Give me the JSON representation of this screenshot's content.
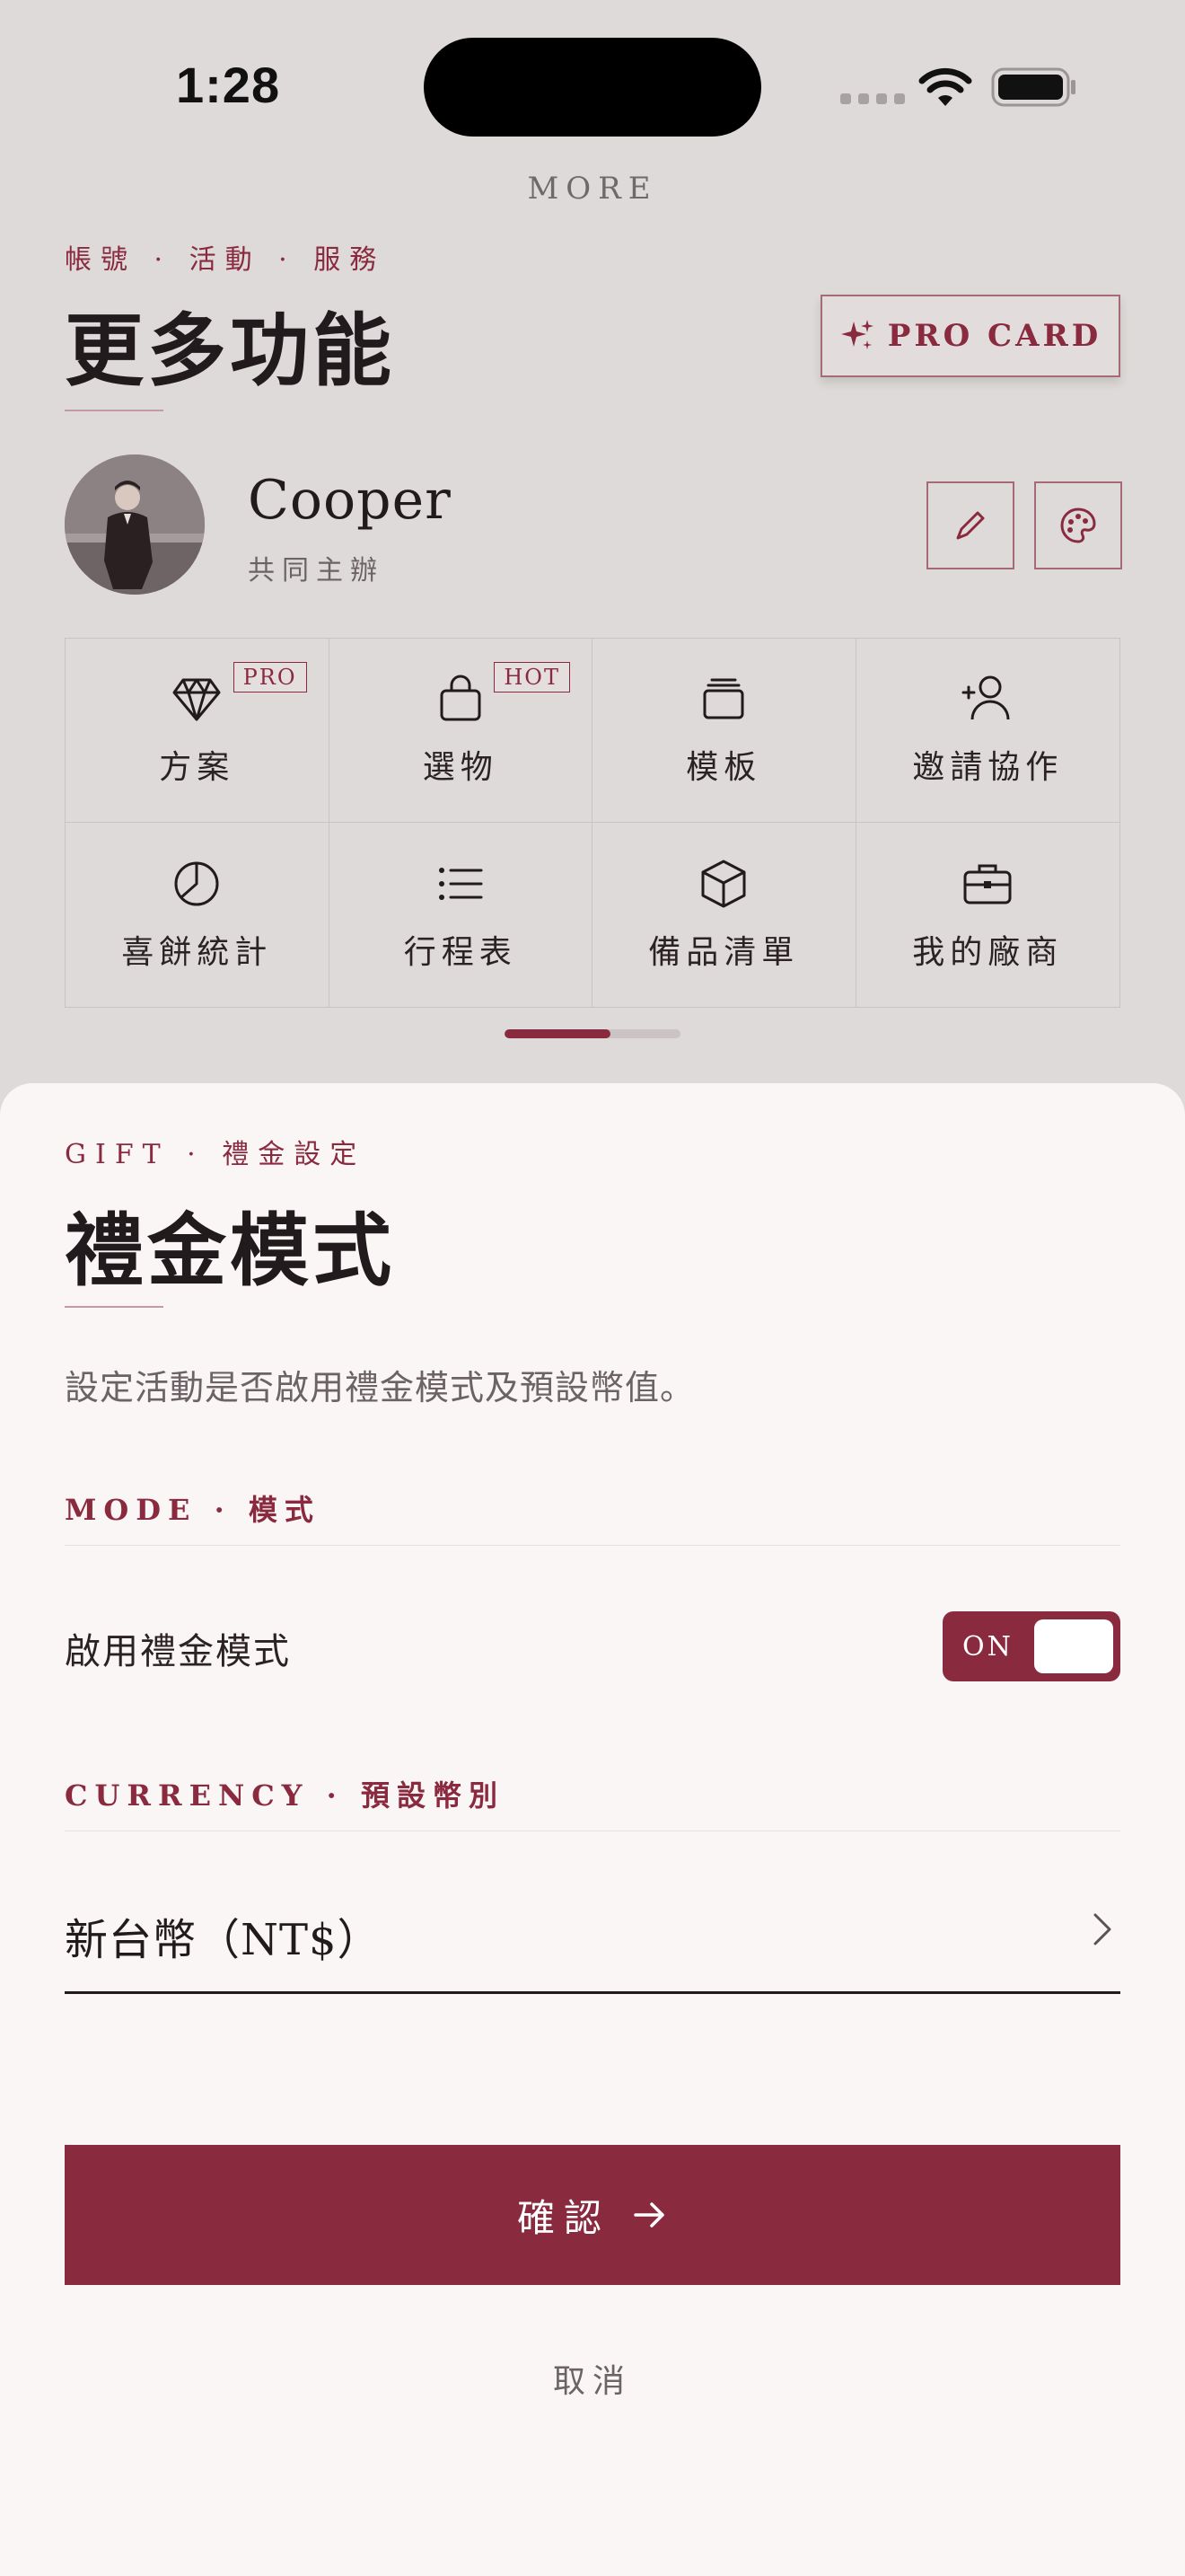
{
  "status_bar": {
    "time": "1:28"
  },
  "page": {
    "more_label": "MORE",
    "eyebrow": "帳號 · 活動 · 服務",
    "title": "更多功能",
    "pro_card_label": "PRO CARD"
  },
  "profile": {
    "name": "Cooper",
    "role": "共同主辦"
  },
  "features": [
    {
      "label": "方案",
      "tag": "PRO",
      "icon": "diamond-icon"
    },
    {
      "label": "選物",
      "tag": "HOT",
      "icon": "shopping-bag-icon"
    },
    {
      "label": "模板",
      "tag": "",
      "icon": "layers-icon"
    },
    {
      "label": "邀請協作",
      "tag": "",
      "icon": "user-plus-icon"
    },
    {
      "label": "喜餅統計",
      "tag": "",
      "icon": "pie-chart-icon"
    },
    {
      "label": "行程表",
      "tag": "",
      "icon": "list-icon"
    },
    {
      "label": "備品清單",
      "tag": "",
      "icon": "box-icon"
    },
    {
      "label": "我的廠商",
      "tag": "",
      "icon": "briefcase-icon"
    }
  ],
  "pager": {
    "progress": 0.6
  },
  "sheet": {
    "eyebrow": "GIFT · 禮金設定",
    "title": "禮金模式",
    "description": "設定活動是否啟用禮金模式及預設幣值。",
    "mode_section": "MODE · 模式",
    "enable_label": "啟用禮金模式",
    "toggle_state": "ON",
    "currency_section": "CURRENCY · 預設幣別",
    "currency_value": "新台幣（NT$）",
    "confirm_label": "確認",
    "cancel_label": "取消"
  },
  "colors": {
    "accent": "#8a2a3f",
    "sheet_bg": "#faf6f5",
    "dim_bg": "#dedad9"
  }
}
